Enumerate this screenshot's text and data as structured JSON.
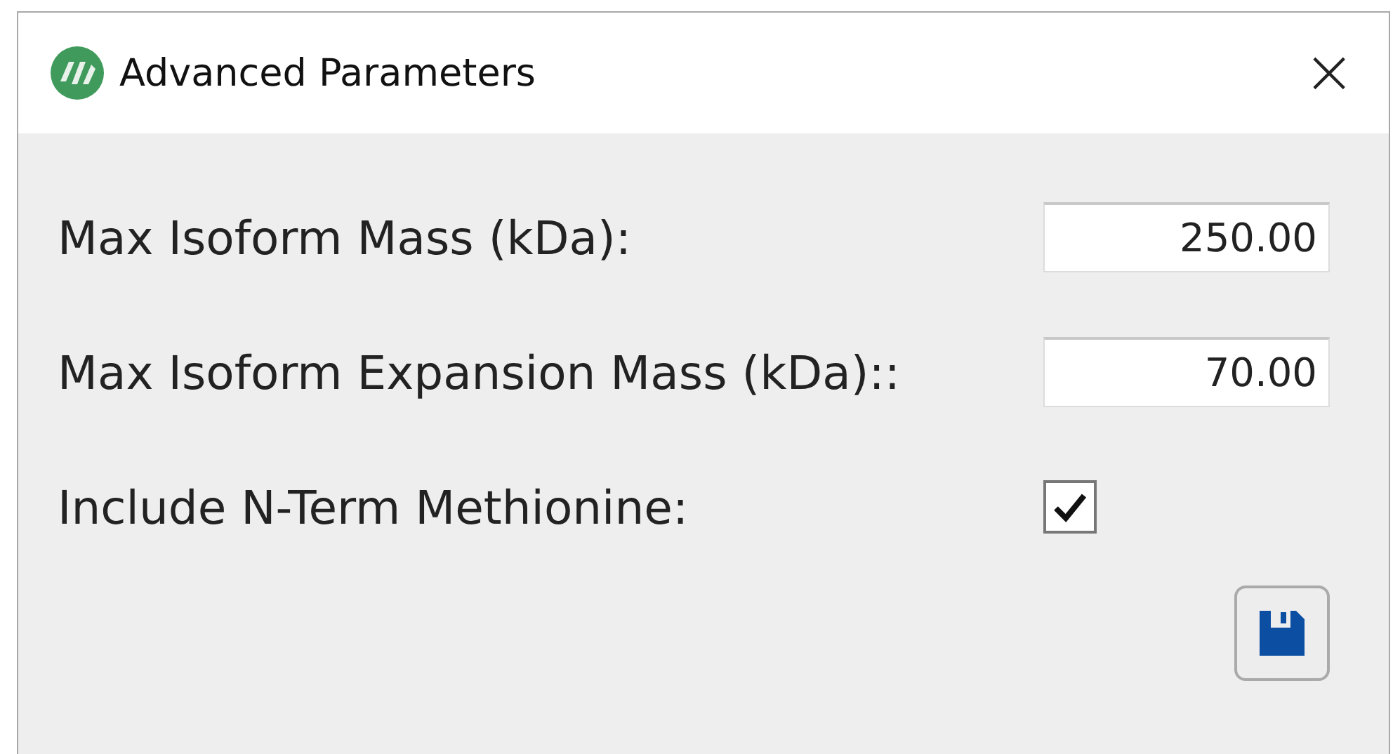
{
  "window": {
    "title": "Advanced Parameters",
    "close": "×"
  },
  "fields": [
    {
      "kind": "number",
      "label": "Max Isoform Mass (kDa):",
      "value": "250.00"
    },
    {
      "kind": "number",
      "label": "Max Isoform Expansion Mass (kDa)::",
      "value": "70.00"
    },
    {
      "kind": "checkbox",
      "label": "Include N-Term Methionine:",
      "checked": true
    }
  ]
}
